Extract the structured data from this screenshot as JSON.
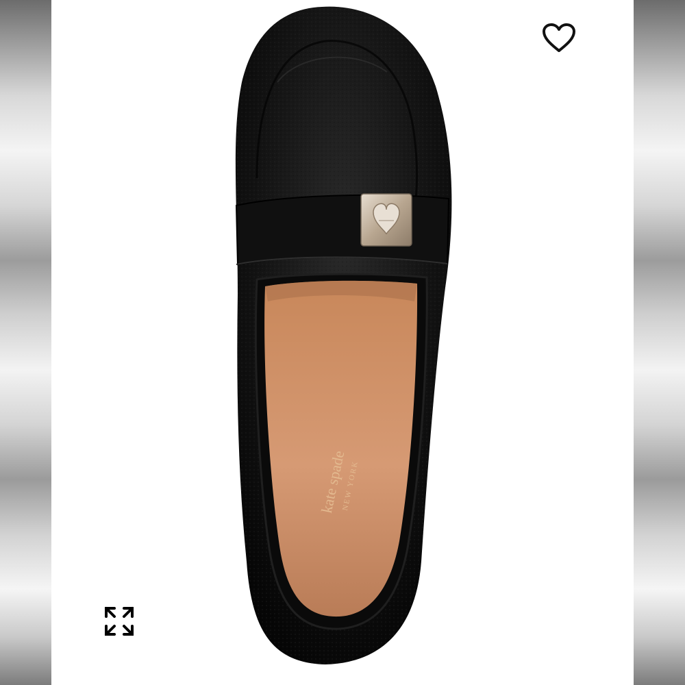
{
  "product_image": {
    "alt": "kate spade new york black pebbled leather loafer, top view",
    "insole_logo": {
      "line1": "kate spade",
      "line2": "NEW YORK"
    }
  },
  "favorite_button": {
    "icon": "heart-outline-icon"
  },
  "expand_button": {
    "icon": "expand-arrows-icon"
  },
  "colors": {
    "leather": "#111111",
    "insole": "#c98c62",
    "hardware": "#c9b8a4",
    "logo_foil": "#e3b98f"
  }
}
